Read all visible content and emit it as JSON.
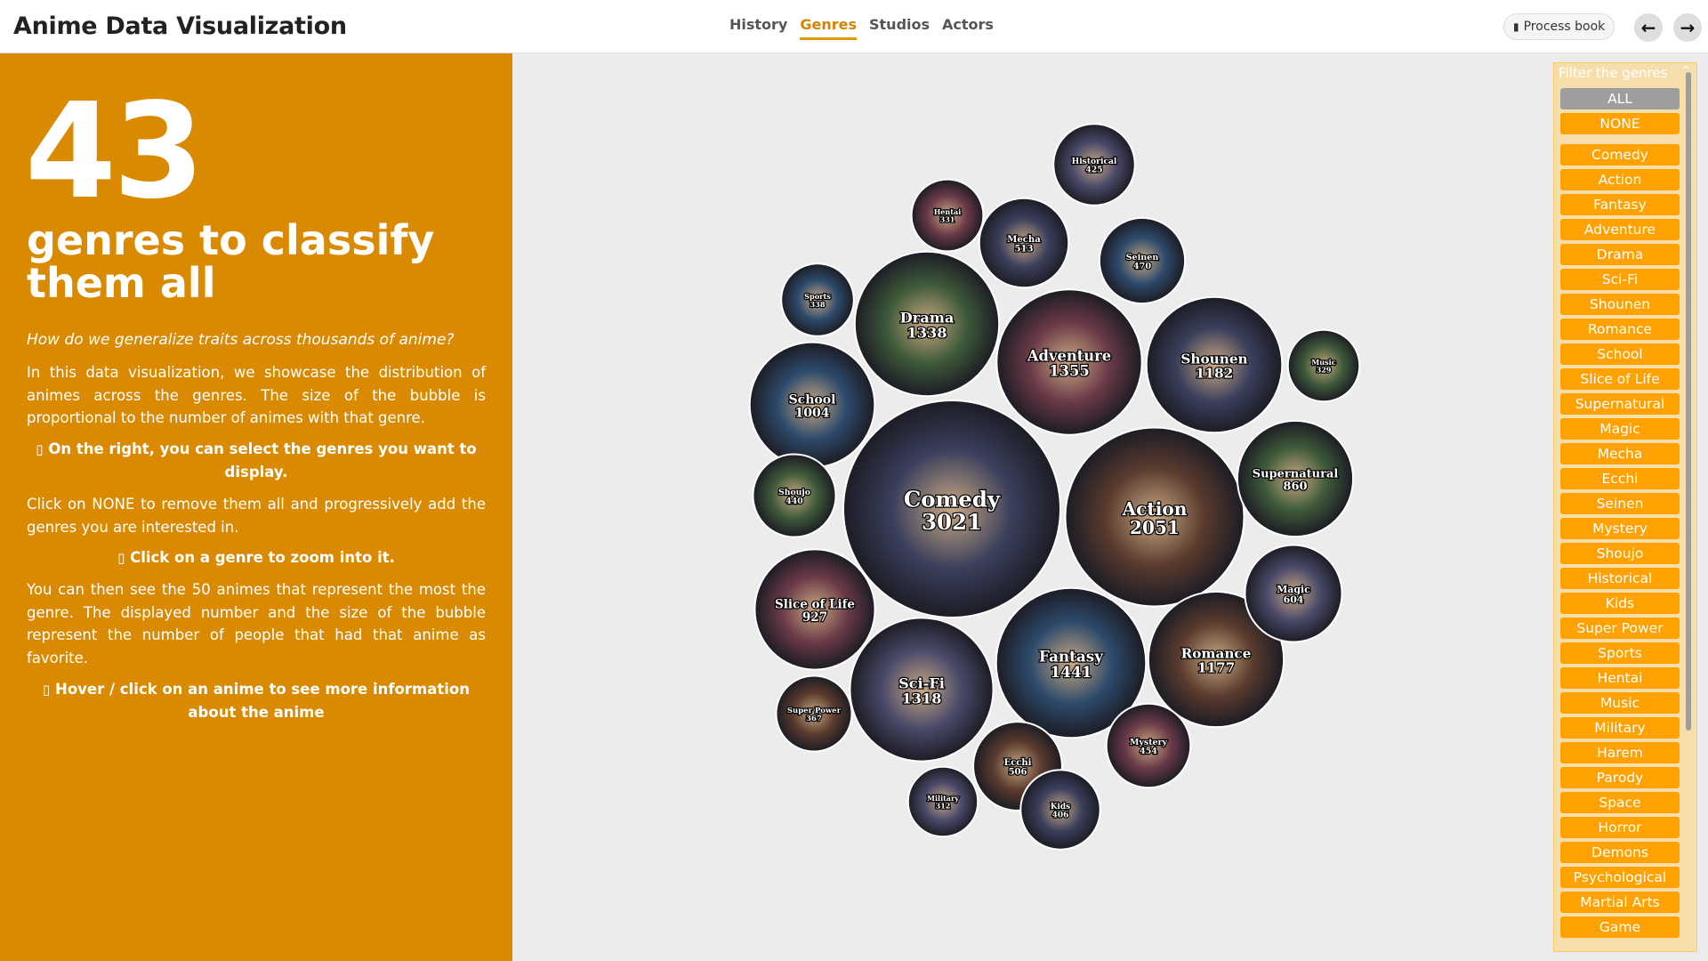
{
  "navbar": {
    "brand": "Anime Data Visualization",
    "tabs": [
      {
        "label": "History",
        "active": false
      },
      {
        "label": "Genres",
        "active": true
      },
      {
        "label": "Studios",
        "active": false
      },
      {
        "label": "Actors",
        "active": false
      }
    ],
    "process_book_label": "Process book",
    "back_icon": "arrow-left-icon",
    "forward_icon": "arrow-right-icon"
  },
  "left_panel": {
    "big_number": "43",
    "headline": "genres to classify them all",
    "question": "How do we generalize traits across thousands of anime?",
    "intro": "In this data visualization, we showcase the distribution of animes across the genres. The size of the bubble is proportional to the number of animes with that genre.",
    "tip_select": "On the right, you can select the genres you want to display.",
    "none_hint": "Click on NONE to remove them all and progressively add the genres you are interested in.",
    "tip_zoom": "Click on a genre to zoom into it.",
    "detail": "You can then see the 50 animes that represent the most the genre. The displayed number and the size of the bubble represent the number of people that had that anime as favorite.",
    "tip_hover": "Hover / click on an anime to see more information about the anime"
  },
  "colors": {
    "accent": "#d98a00",
    "filter_button": "#ffa200",
    "filter_all": "#9e9e9e",
    "chart_background": "#ececec"
  },
  "chart_data": {
    "type": "bubble",
    "series": [
      {
        "name": "Comedy",
        "value": 3021
      },
      {
        "name": "Action",
        "value": 2051
      },
      {
        "name": "Fantasy",
        "value": 1441
      },
      {
        "name": "Adventure",
        "value": 1355
      },
      {
        "name": "Drama",
        "value": 1338
      },
      {
        "name": "Sci-Fi",
        "value": 1318
      },
      {
        "name": "Shounen",
        "value": 1182
      },
      {
        "name": "Romance",
        "value": 1177
      },
      {
        "name": "School",
        "value": 1004
      },
      {
        "name": "Slice of Life",
        "value": 927
      },
      {
        "name": "Supernatural",
        "value": 860
      },
      {
        "name": "Magic",
        "value": 604
      },
      {
        "name": "Mecha",
        "value": 513
      },
      {
        "name": "Ecchi",
        "value": 506
      },
      {
        "name": "Seinen",
        "value": 470
      },
      {
        "name": "Mystery",
        "value": 454
      },
      {
        "name": "Shoujo",
        "value": 440
      },
      {
        "name": "Historical",
        "value": 425
      },
      {
        "name": "Kids",
        "value": 406
      },
      {
        "name": "Super Power",
        "value": 367
      },
      {
        "name": "Sports",
        "value": 338
      },
      {
        "name": "Hentai",
        "value": 331
      },
      {
        "name": "Music",
        "value": 329
      },
      {
        "name": "Military",
        "value": 312
      }
    ]
  },
  "filter": {
    "header": "Filter the genres",
    "all_label": "ALL",
    "none_label": "NONE",
    "genres": [
      "Comedy",
      "Action",
      "Fantasy",
      "Adventure",
      "Drama",
      "Sci-Fi",
      "Shounen",
      "Romance",
      "School",
      "Slice of Life",
      "Supernatural",
      "Magic",
      "Mecha",
      "Ecchi",
      "Seinen",
      "Mystery",
      "Shoujo",
      "Historical",
      "Kids",
      "Super Power",
      "Sports",
      "Hentai",
      "Music",
      "Military",
      "Harem",
      "Parody",
      "Space",
      "Horror",
      "Demons",
      "Psychological",
      "Martial Arts",
      "Game"
    ]
  }
}
